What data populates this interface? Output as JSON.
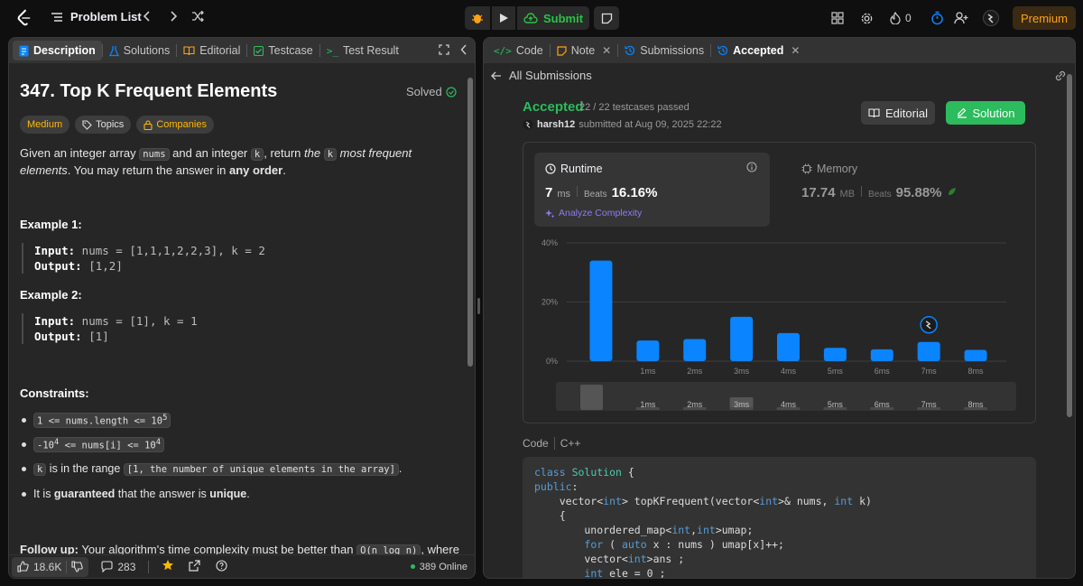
{
  "topbar": {
    "problem_list": "Problem List",
    "submit": "Submit",
    "streak": "0",
    "premium": "Premium"
  },
  "left": {
    "tabs": [
      "Description",
      "Solutions",
      "Editorial",
      "Testcase",
      "Test Result"
    ],
    "title": "347. Top K Frequent Elements",
    "solved": "Solved",
    "tags": [
      "Medium",
      "Topics",
      "Companies"
    ],
    "desc": {
      "p1a": "Given an integer array ",
      "nums": "nums",
      "p1b": " and an integer ",
      "k": "k",
      "p1c": ", return ",
      "the": "the ",
      "k2": "k",
      "mfe": " most frequent elements",
      "p1d": ". You may return the answer in ",
      "any": "any order",
      "p1e": "."
    },
    "ex1_title": "Example 1:",
    "ex1_input_label": "Input:",
    "ex1_input": " nums = [1,1,1,2,2,3], k = 2",
    "ex1_output_label": "Output:",
    "ex1_output": " [1,2]",
    "ex2_title": "Example 2:",
    "ex2_input_label": "Input:",
    "ex2_input": " nums = [1], k = 1",
    "ex2_output_label": "Output:",
    "ex2_output": " [1]",
    "constraints_title": "Constraints:",
    "c1a": "1 <= nums.length <= 10",
    "c1sup": "5",
    "c2a": "-10",
    "c2sup": "4",
    "c2b": " <= nums[i] <= 10",
    "c2sup2": "4",
    "c3k": "k",
    "c3a": " is in the range ",
    "c3code": "[1, the number of unique elements in the array]",
    "c3b": ".",
    "c4a": "It is ",
    "c4b": "guaranteed",
    "c4c": " that the answer is ",
    "c4d": "unique",
    "c4e": ".",
    "followup_bold": "Follow up:",
    "followup": " Your algorithm's time complexity must be better than ",
    "followup_code": "O(n log n)",
    "followup_end": ", where n is",
    "likes": "18.6K",
    "comments": "283",
    "online": "389 Online"
  },
  "right": {
    "tabs": [
      "Code",
      "Note",
      "Submissions",
      "Accepted"
    ],
    "all_submissions": "All Submissions",
    "status": "Accepted",
    "passed": "22 / 22 testcases passed",
    "user": "harsh12",
    "submitted": "submitted at Aug 09, 2025 22:22",
    "editorial_btn": "Editorial",
    "solution_btn": "Solution",
    "runtime_label": "Runtime",
    "runtime_value": "7",
    "runtime_unit": "ms",
    "beats_label": "Beats",
    "runtime_beats": "16.16%",
    "analyze": "Analyze Complexity",
    "memory_label": "Memory",
    "memory_value": "17.74",
    "memory_unit": "MB",
    "memory_beats": "95.88%",
    "code_label": "Code",
    "lang": "C++"
  },
  "chart_data": {
    "type": "bar",
    "categories": [
      "",
      "1ms",
      "2ms",
      "3ms",
      "4ms",
      "5ms",
      "6ms",
      "7ms",
      "8ms"
    ],
    "values": [
      34,
      7,
      7.5,
      15,
      9.5,
      4.5,
      4,
      6.5,
      3.8
    ],
    "ylim": [
      0,
      40
    ],
    "yticks": [
      "0%",
      "20%",
      "40%"
    ],
    "ytick_values": [
      0,
      20,
      40
    ],
    "highlight_category": "7ms",
    "bar_color": "#0a84ff",
    "grid": true
  },
  "colors": {
    "accent_green": "#2cbb5d",
    "brand_orange": "#ffa116",
    "bar_blue": "#0a84ff"
  }
}
